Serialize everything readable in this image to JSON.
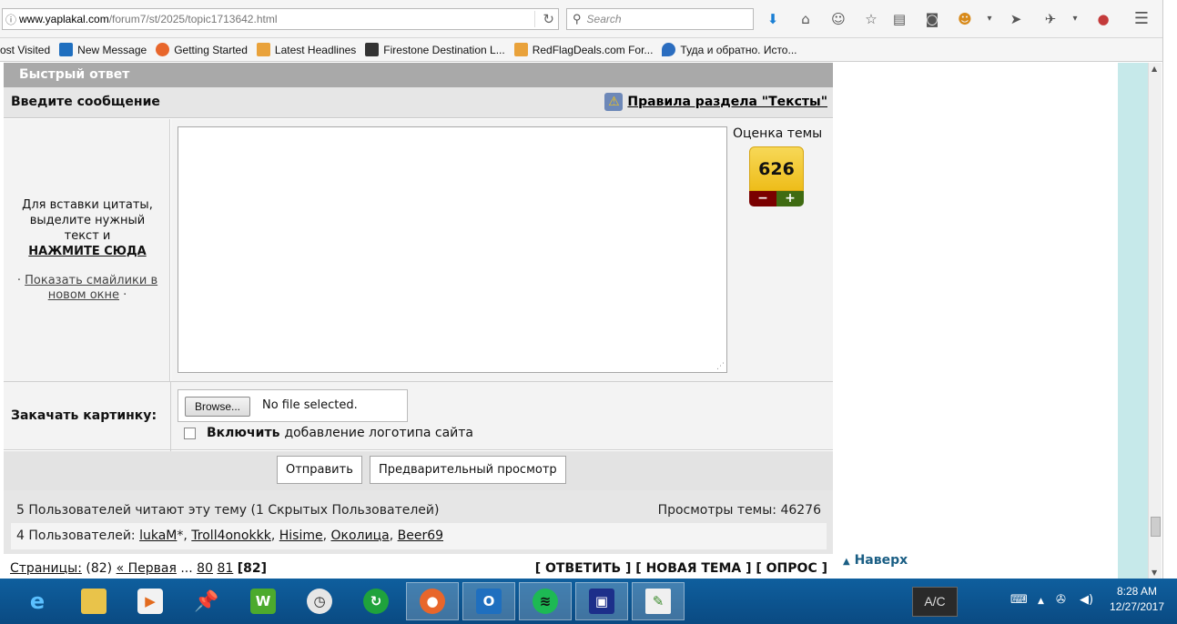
{
  "browser": {
    "url_host": "www.yaplakal.com",
    "url_path": "/forum7/st/2025/topic1713642.html",
    "search_placeholder": "Search"
  },
  "bookmarks": [
    {
      "label": "ost Visited",
      "color": "#ffffff"
    },
    {
      "label": "New Message",
      "color": "#1f6fbf"
    },
    {
      "label": "Getting Started",
      "color": "#e8662b"
    },
    {
      "label": "Latest Headlines",
      "color": "#e9a23b"
    },
    {
      "label": "Firestone Destination L...",
      "color": "#333333"
    },
    {
      "label": "RedFlagDeals.com For...",
      "color": "#e9a23b"
    },
    {
      "label": "Туда и обратно. Исто...",
      "color": "#2b6dbf"
    }
  ],
  "forum": {
    "quick_reply_title": "Быстрый ответ",
    "enter_message": "Введите сообщение",
    "rules_link": "Правила раздела \"Тексты\"",
    "quote_hint": "Для вставки цитаты, выделите нужный текст и",
    "quote_click": "НАЖМИТЕ СЮДА",
    "smiles_prefix": "·",
    "smiles_link": "Показать смайлики в новом окне",
    "smiles_suffix": "·",
    "rating_label": "Оценка темы",
    "rating_value": "626",
    "rating_minus": "−",
    "rating_plus": "+",
    "upload_label": "Закачать картинку:",
    "browse_label": "Browse...",
    "no_file": "No file selected.",
    "logo_bold": "Включить",
    "logo_text": "добавление логотипа сайта",
    "send_label": "Отправить",
    "preview_label": "Предварительный просмотр",
    "readers_line": "5 Пользователей читают эту тему (1 Скрытых Пользователей)",
    "views_label": "Просмотры темы: 46276",
    "users_prefix": "4 Пользователей:",
    "users": [
      "lukaM",
      "Troll4onokkk",
      "Hisime",
      "Околица",
      "Beer69"
    ],
    "user_suffix_0": "*",
    "pages_label": "Страницы:",
    "pages_count": "(82)",
    "first_page": "« Первая",
    "ellipsis": "...",
    "page_80": "80",
    "page_81": "81",
    "current_page": "[82]",
    "actions": "[ ОТВЕТИТЬ ] [ НОВАЯ ТЕМА ] [ ОПРОС ]",
    "to_top": "Наверх"
  },
  "taskbar": {
    "apps": [
      "internet-explorer",
      "file-explorer",
      "media-player",
      "pin-app",
      "w-app",
      "clock-app",
      "green-app",
      "firefox",
      "outlook",
      "spotify",
      "floppy-app",
      "notepad-app"
    ],
    "ac_label": "A/C",
    "time": "8:28 AM",
    "date": "12/27/2017"
  }
}
